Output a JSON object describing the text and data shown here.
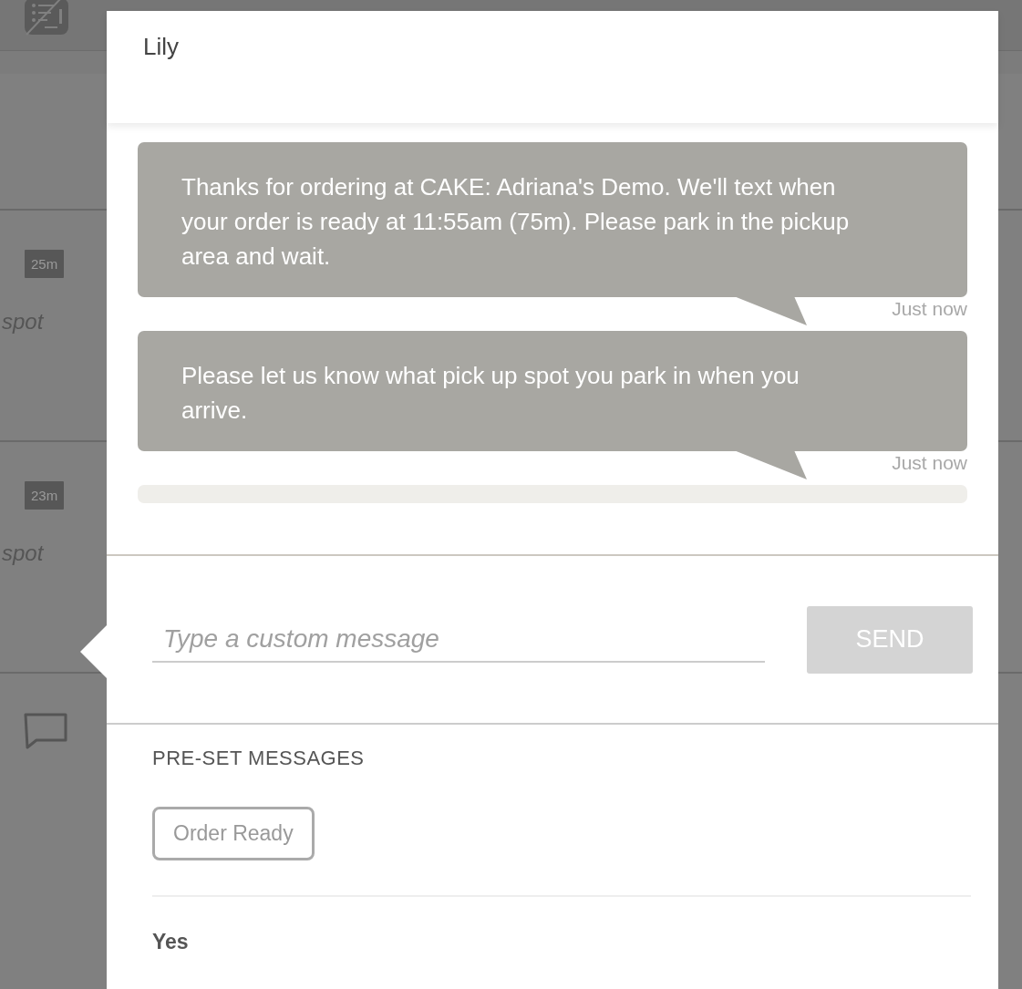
{
  "contact": {
    "name": "Lily"
  },
  "background_rows": [
    {
      "kind": "badge",
      "badge": "25m",
      "note": "spot"
    },
    {
      "kind": "badge",
      "badge": "23m",
      "note": "spot"
    },
    {
      "kind": "chat"
    }
  ],
  "messages": [
    {
      "text": "Thanks for ordering at CAKE: Adriana's Demo. We'll text when your order is ready at 11:55am (75m). Please park in the pickup area and wait.",
      "time": "Just now"
    },
    {
      "text": "Please let us know what pick up spot you park in when you arrive.",
      "time": "Just now"
    }
  ],
  "composer": {
    "placeholder": "Type a custom message",
    "send": "SEND",
    "disabled": true
  },
  "preset": {
    "heading": "PRE-SET MESSAGES",
    "buttons": [
      "Order Ready"
    ],
    "replies": [
      "Yes"
    ]
  }
}
